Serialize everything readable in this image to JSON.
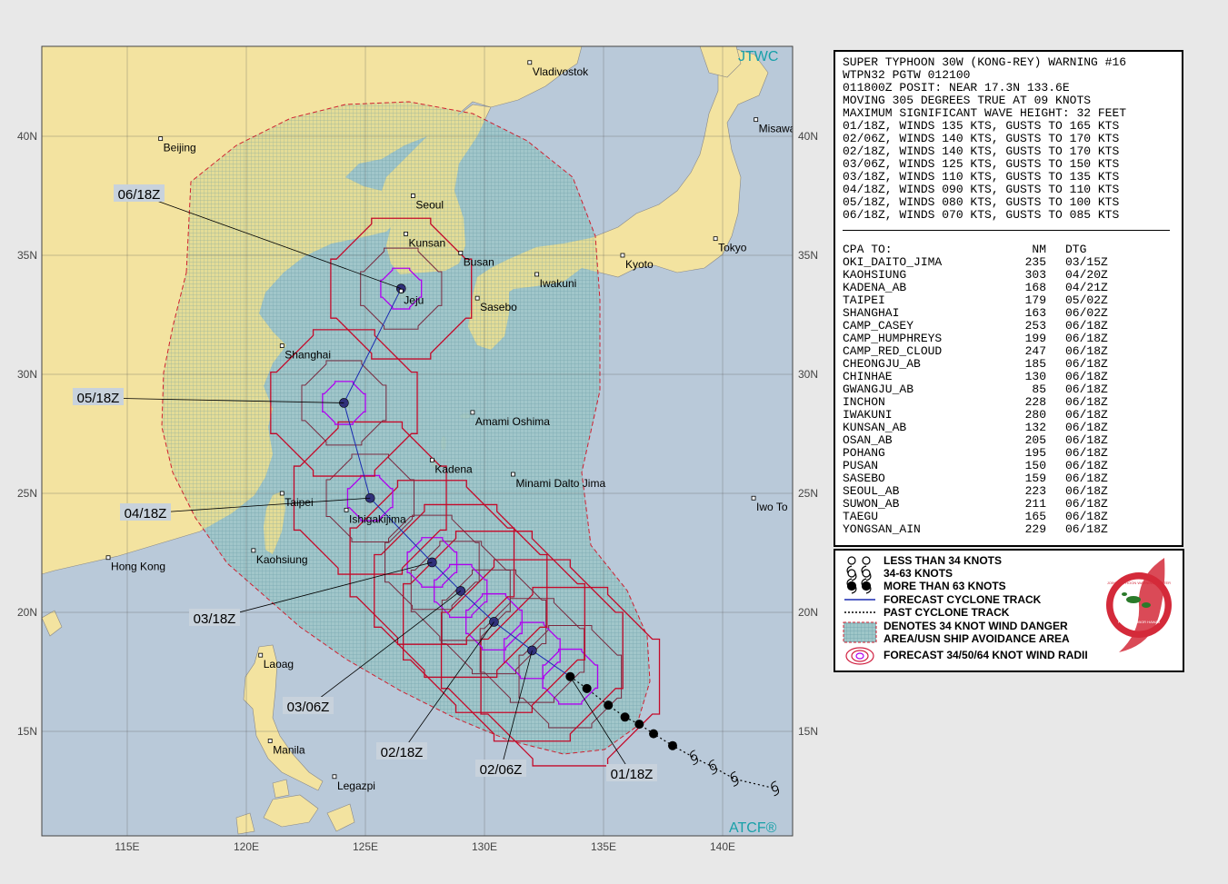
{
  "map": {
    "agency_label": "JTWC",
    "atcf_label": "ATCF®",
    "lon_labels": [
      "115E",
      "120E",
      "125E",
      "130E",
      "135E",
      "140E"
    ],
    "lat_labels": [
      "40N",
      "35N",
      "30N",
      "25N",
      "20N",
      "15N"
    ],
    "cities": [
      {
        "name": "Vladivostok",
        "lon": 131.9,
        "lat": 43.1
      },
      {
        "name": "Beijing",
        "lon": 116.4,
        "lat": 39.9
      },
      {
        "name": "Misawa",
        "lon": 141.4,
        "lat": 40.7
      },
      {
        "name": "Seoul",
        "lon": 127.0,
        "lat": 37.5
      },
      {
        "name": "Kunsan",
        "lon": 126.7,
        "lat": 35.9
      },
      {
        "name": "Busan",
        "lon": 129.0,
        "lat": 35.1
      },
      {
        "name": "Kyoto",
        "lon": 135.8,
        "lat": 35.0
      },
      {
        "name": "Tokyo",
        "lon": 139.7,
        "lat": 35.7
      },
      {
        "name": "Iwakuni",
        "lon": 132.2,
        "lat": 34.2
      },
      {
        "name": "Jeju",
        "lon": 126.5,
        "lat": 33.5
      },
      {
        "name": "Sasebo",
        "lon": 129.7,
        "lat": 33.2
      },
      {
        "name": "Shanghai",
        "lon": 121.5,
        "lat": 31.2
      },
      {
        "name": "Amami Oshima",
        "lon": 129.5,
        "lat": 28.4
      },
      {
        "name": "Kadena",
        "lon": 127.8,
        "lat": 26.4
      },
      {
        "name": "Minami Dalto Jima",
        "lon": 131.2,
        "lat": 25.8
      },
      {
        "name": "Taipei",
        "lon": 121.5,
        "lat": 25.0
      },
      {
        "name": "Ishigakijima",
        "lon": 124.2,
        "lat": 24.3
      },
      {
        "name": "Iwo To",
        "lon": 141.3,
        "lat": 24.8
      },
      {
        "name": "Hong Kong",
        "lon": 114.2,
        "lat": 22.3
      },
      {
        "name": "Kaohsiung",
        "lon": 120.3,
        "lat": 22.6
      },
      {
        "name": "Laoag",
        "lon": 120.6,
        "lat": 18.2
      },
      {
        "name": "Manila",
        "lon": 121.0,
        "lat": 14.6
      },
      {
        "name": "Legazpi",
        "lon": 123.7,
        "lat": 13.1
      }
    ],
    "forecast_points": [
      {
        "label": "01/18Z",
        "lon": 133.6,
        "lat": 17.3,
        "wind_kts": 135
      },
      {
        "label": "02/06Z",
        "lon": 132.0,
        "lat": 18.4,
        "wind_kts": 140
      },
      {
        "label": "02/18Z",
        "lon": 130.4,
        "lat": 19.6,
        "wind_kts": 140
      },
      {
        "label": "03/06Z",
        "lon": 129.0,
        "lat": 20.9,
        "wind_kts": 125
      },
      {
        "label": "03/18Z",
        "lon": 127.8,
        "lat": 22.1,
        "wind_kts": 110
      },
      {
        "label": "04/18Z",
        "lon": 125.2,
        "lat": 24.8,
        "wind_kts": 90
      },
      {
        "label": "05/18Z",
        "lon": 124.1,
        "lat": 28.8,
        "wind_kts": 80
      },
      {
        "label": "06/18Z",
        "lon": 126.5,
        "lat": 33.6,
        "wind_kts": 70
      }
    ],
    "past_track": [
      {
        "lon": 134.3,
        "lat": 16.8,
        "type": "strong"
      },
      {
        "lon": 135.2,
        "lat": 16.1,
        "type": "strong"
      },
      {
        "lon": 135.9,
        "lat": 15.6,
        "type": "strong"
      },
      {
        "lon": 136.5,
        "lat": 15.3,
        "type": "strong"
      },
      {
        "lon": 137.1,
        "lat": 14.9,
        "type": "strong"
      },
      {
        "lon": 137.9,
        "lat": 14.4,
        "type": "strong"
      },
      {
        "lon": 138.8,
        "lat": 13.9,
        "type": "moderate"
      },
      {
        "lon": 139.6,
        "lat": 13.5,
        "type": "moderate"
      },
      {
        "lon": 140.5,
        "lat": 13.0,
        "type": "moderate"
      },
      {
        "lon": 142.2,
        "lat": 12.6,
        "type": "moderate"
      }
    ]
  },
  "warning": {
    "lines": [
      "SUPER TYPHOON 30W (KONG-REY) WARNING #16",
      "WTPN32 PGTW 012100",
      "011800Z POSIT: NEAR 17.3N 133.6E",
      "MOVING 305 DEGREES TRUE AT 09 KNOTS",
      "MAXIMUM SIGNIFICANT WAVE HEIGHT: 32 FEET",
      "01/18Z, WINDS 135 KTS, GUSTS TO 165 KTS",
      "02/06Z, WINDS 140 KTS, GUSTS TO 170 KTS",
      "02/18Z, WINDS 140 KTS, GUSTS TO 170 KTS",
      "03/06Z, WINDS 125 KTS, GUSTS TO 150 KTS",
      "03/18Z, WINDS 110 KTS, GUSTS TO 135 KTS",
      "04/18Z, WINDS 090 KTS, GUSTS TO 110 KTS",
      "05/18Z, WINDS 080 KTS, GUSTS TO 100 KTS",
      "06/18Z, WINDS 070 KTS, GUSTS TO 085 KTS"
    ],
    "cpa_header": {
      "name": "CPA TO:",
      "nm": "NM",
      "dtg": "DTG"
    },
    "cpa": [
      {
        "name": "OKI_DAITO_JIMA",
        "nm": "235",
        "dtg": "03/15Z"
      },
      {
        "name": "KAOHSIUNG",
        "nm": "303",
        "dtg": "04/20Z"
      },
      {
        "name": "KADENA_AB",
        "nm": "168",
        "dtg": "04/21Z"
      },
      {
        "name": "TAIPEI",
        "nm": "179",
        "dtg": "05/02Z"
      },
      {
        "name": "SHANGHAI",
        "nm": "163",
        "dtg": "06/02Z"
      },
      {
        "name": "CAMP_CASEY",
        "nm": "253",
        "dtg": "06/18Z"
      },
      {
        "name": "CAMP_HUMPHREYS",
        "nm": "199",
        "dtg": "06/18Z"
      },
      {
        "name": "CAMP_RED_CLOUD",
        "nm": "247",
        "dtg": "06/18Z"
      },
      {
        "name": "CHEONGJU_AB",
        "nm": "185",
        "dtg": "06/18Z"
      },
      {
        "name": "CHINHAE",
        "nm": "130",
        "dtg": "06/18Z"
      },
      {
        "name": "GWANGJU_AB",
        "nm": "85",
        "dtg": "06/18Z"
      },
      {
        "name": "INCHON",
        "nm": "228",
        "dtg": "06/18Z"
      },
      {
        "name": "IWAKUNI",
        "nm": "280",
        "dtg": "06/18Z"
      },
      {
        "name": "KUNSAN_AB",
        "nm": "132",
        "dtg": "06/18Z"
      },
      {
        "name": "OSAN_AB",
        "nm": "205",
        "dtg": "06/18Z"
      },
      {
        "name": "POHANG",
        "nm": "195",
        "dtg": "06/18Z"
      },
      {
        "name": "PUSAN",
        "nm": "150",
        "dtg": "06/18Z"
      },
      {
        "name": "SASEBO",
        "nm": "159",
        "dtg": "06/18Z"
      },
      {
        "name": "SEOUL_AB",
        "nm": "223",
        "dtg": "06/18Z"
      },
      {
        "name": "SUWON_AB",
        "nm": "211",
        "dtg": "06/18Z"
      },
      {
        "name": "TAEGU",
        "nm": "165",
        "dtg": "06/18Z"
      },
      {
        "name": "YONGSAN_AIN",
        "nm": "229",
        "dtg": "06/18Z"
      }
    ]
  },
  "legend": {
    "items": [
      "LESS THAN 34 KNOTS",
      "34-63 KNOTS",
      "MORE THAN 63 KNOTS",
      "FORECAST CYCLONE TRACK",
      "PAST CYCLONE TRACK",
      "DENOTES 34 KNOT WIND DANGER",
      "AREA/USN SHIP AVOIDANCE AREA",
      "FORECAST 34/50/64 KNOT WIND RADII"
    ],
    "seal": {
      "top_text": "JOINT TYPHOON WARNING CENTER",
      "bottom_text": "PEARL HARBOR HAWAII"
    }
  },
  "colors": {
    "ocean": "#b9c9d9",
    "land": "#f3e3a0",
    "danger_fill": "#85b4bb",
    "radius_34": "#c40a2a",
    "radius_50": "#7a2a40",
    "radius_64": "#b000f0",
    "track": "#1a2ab0",
    "label_bg": "#c8d2dc"
  }
}
